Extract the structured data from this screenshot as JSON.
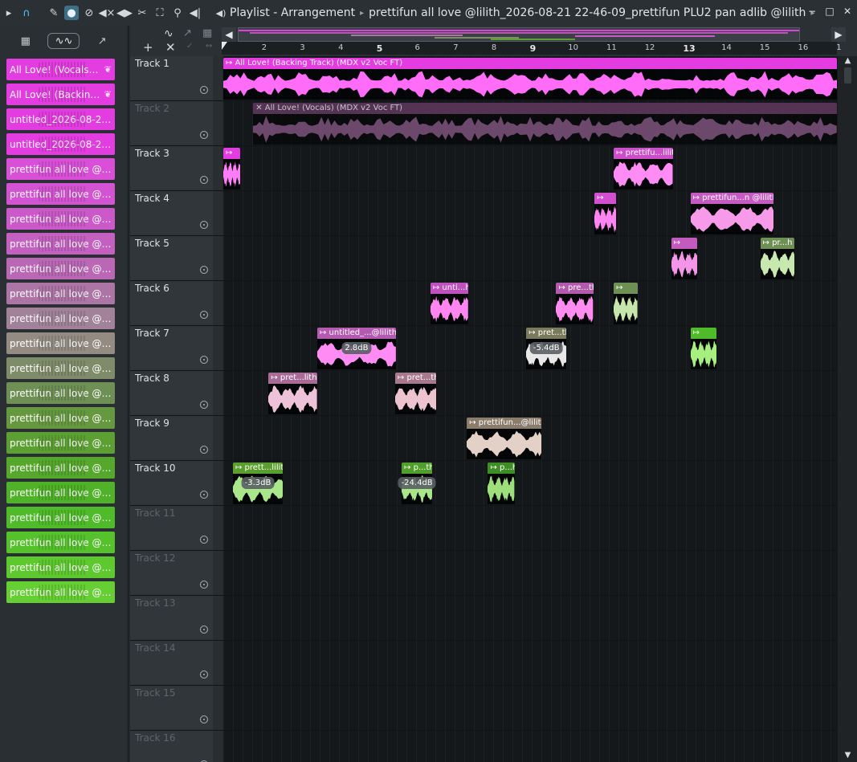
{
  "window": {
    "title_parts": [
      "Playlist - Arrangement",
      "prettifun all love @lilith_2026-08-21 22-46-09_prettifun PLU2 pan adlib @lilith"
    ],
    "controls": [
      "−",
      "□",
      "✕"
    ]
  },
  "toolbar_icons": [
    "play-arrow",
    "magnet",
    "pencil",
    "brush",
    "mute",
    "erase",
    "slip",
    "slice",
    "select",
    "zoom",
    "speaker"
  ],
  "sidebar": {
    "tabs": [
      "piano-roll",
      "audio",
      "automation"
    ],
    "clips": [
      {
        "label": "All Love! (Vocals) (MD…",
        "color": "#e33ce0"
      },
      {
        "label": "All Love! (Backing Tra…",
        "color": "#e33ce0"
      },
      {
        "label": "untitled_2026-08-21 22-…",
        "color": "#e33ce0"
      },
      {
        "label": "untitled_2026-08-21 22-…",
        "color": "#e33ce0"
      },
      {
        "label": "prettifun all love @lilith_…",
        "color": "#d94fd8"
      },
      {
        "label": "prettifun all love @lilith_…",
        "color": "#d453d2"
      },
      {
        "label": "prettifun all love @lilith_…",
        "color": "#cc59c9"
      },
      {
        "label": "prettifun all love @lilith_…",
        "color": "#c460bf"
      },
      {
        "label": "prettifun all love @lilith_…",
        "color": "#ba68b5"
      },
      {
        "label": "prettifun all love @lilith_…",
        "color": "#ad74a6"
      },
      {
        "label": "prettifun all love @lilith_…",
        "color": "#a28299"
      },
      {
        "label": "prettifun all love @lilith_…",
        "color": "#948c83"
      },
      {
        "label": "prettifun all love @lilith_…",
        "color": "#7f8c6a"
      },
      {
        "label": "prettifun all love @lilith_…",
        "color": "#6f9055"
      },
      {
        "label": "prettifun all love @lilith_…",
        "color": "#66993f"
      },
      {
        "label": "prettifun all love @lilith_…",
        "color": "#5c9f33"
      },
      {
        "label": "prettifun all love @lilith_…",
        "color": "#55a82c"
      },
      {
        "label": "prettifun all love @lilith_…",
        "color": "#50b228"
      },
      {
        "label": "prettifun all love @lilith_…",
        "color": "#4fbb2a"
      },
      {
        "label": "prettifun all love @lilith_…",
        "color": "#55c22c"
      },
      {
        "label": "prettifun all love @lilith_…",
        "color": "#5ec92f"
      },
      {
        "label": "prettifun all love @lilith_…",
        "color": "#66cf33"
      }
    ]
  },
  "ruler": {
    "bars": [
      "2",
      "3",
      "4",
      "5",
      "6",
      "7",
      "8",
      "9",
      "10",
      "11",
      "12",
      "13",
      "14",
      "15",
      "16",
      "1"
    ],
    "major_bars": [
      "5",
      "9",
      "13"
    ]
  },
  "tracks": [
    {
      "name": "Track 1",
      "muted": false,
      "clips": [
        {
          "label": "All Love! (Backing Track) (MDX v2 Voc FT)",
          "start": 0,
          "end": 16,
          "color": "#e33ce0",
          "wave": "#ff6cf8",
          "dense": true
        }
      ]
    },
    {
      "name": "Track 2",
      "muted": true,
      "clips": [
        {
          "label": "All Love! (Vocals) (MDX v2 Voc FT)",
          "start": 0.78,
          "end": 16,
          "color": "#6a3c68",
          "wave": "#8a5a87",
          "dense": true,
          "disabled": true
        }
      ]
    },
    {
      "name": "Track 3",
      "muted": false,
      "clips": [
        {
          "label": "",
          "start": 0,
          "end": 0.45,
          "color": "#e33ce0",
          "wave": "#ff7cf7"
        },
        {
          "label": "prettifu...lilith",
          "start": 10.18,
          "end": 11.72,
          "color": "#cc4ec8",
          "wave": "#ff8cf4"
        }
      ]
    },
    {
      "name": "Track 4",
      "muted": false,
      "clips": [
        {
          "label": "",
          "start": 9.68,
          "end": 10.25,
          "color": "#d44ed0",
          "wave": "#ff86f2"
        },
        {
          "label": "prettifun...n @lilith",
          "start": 12.18,
          "end": 14.35,
          "color": "#c55bc0",
          "wave": "#f69ae9"
        }
      ]
    },
    {
      "name": "Track 5",
      "muted": false,
      "clips": [
        {
          "label": "",
          "start": 11.68,
          "end": 12.35,
          "color": "#c25bbd",
          "wave": "#f595e9"
        },
        {
          "label": "pr...h",
          "start": 14.0,
          "end": 14.9,
          "color": "#6f9055",
          "wave": "#c7e8ae"
        }
      ]
    },
    {
      "name": "Track 6",
      "muted": false,
      "clips": [
        {
          "label": "unti...h",
          "start": 5.4,
          "end": 6.38,
          "color": "#c04fbf",
          "wave": "#ff86f1"
        },
        {
          "label": "pre...th",
          "start": 8.68,
          "end": 9.65,
          "color": "#b45aad",
          "wave": "#ff8cf0"
        },
        {
          "label": "",
          "start": 10.18,
          "end": 10.8,
          "color": "#6f9055",
          "wave": "#c7e6ad"
        }
      ]
    },
    {
      "name": "Track 7",
      "muted": false,
      "clips": [
        {
          "label": "untitled_...@lilith",
          "start": 2.45,
          "end": 4.5,
          "color": "#b45ab0",
          "wave": "#ff8cf5",
          "vol": "2.8dB"
        },
        {
          "label": "pret...th",
          "start": 7.9,
          "end": 8.95,
          "color": "#7a7a5c",
          "wave": "#e9e8e8",
          "vol": "-5.4dB"
        },
        {
          "label": "",
          "start": 12.18,
          "end": 12.85,
          "color": "#4fbb2a",
          "wave": "#a7f07f"
        }
      ]
    },
    {
      "name": "Track 8",
      "muted": false,
      "clips": [
        {
          "label": "pret...lith",
          "start": 1.18,
          "end": 2.45,
          "color": "#a86b98",
          "wave": "#eec3d9"
        },
        {
          "label": "pret...th",
          "start": 4.48,
          "end": 5.55,
          "color": "#a8788c",
          "wave": "#eec3d0"
        }
      ]
    },
    {
      "name": "Track 9",
      "muted": false,
      "clips": [
        {
          "label": "prettifun...@lilith",
          "start": 6.35,
          "end": 8.3,
          "color": "#8c7c6c",
          "wave": "#e3d1c7"
        }
      ]
    },
    {
      "name": "Track 10",
      "muted": false,
      "clips": [
        {
          "label": "prett...lilith",
          "start": 0.25,
          "end": 1.55,
          "color": "#5a9e2e",
          "wave": "#a9e78a",
          "vol": "-3.3dB"
        },
        {
          "label": "p...th",
          "start": 4.65,
          "end": 5.45,
          "color": "#4f9f2a",
          "wave": "#a9e78a",
          "vol": "-24.4dB"
        },
        {
          "label": "p...h",
          "start": 6.9,
          "end": 7.6,
          "color": "#3d8f24",
          "wave": "#9edf7b"
        }
      ]
    },
    {
      "name": "Track 11",
      "muted": true,
      "clips": []
    },
    {
      "name": "Track 12",
      "muted": true,
      "clips": []
    },
    {
      "name": "Track 13",
      "muted": true,
      "clips": []
    },
    {
      "name": "Track 14",
      "muted": true,
      "clips": []
    },
    {
      "name": "Track 15",
      "muted": true,
      "clips": []
    },
    {
      "name": "Track 16",
      "muted": true,
      "clips": []
    }
  ]
}
